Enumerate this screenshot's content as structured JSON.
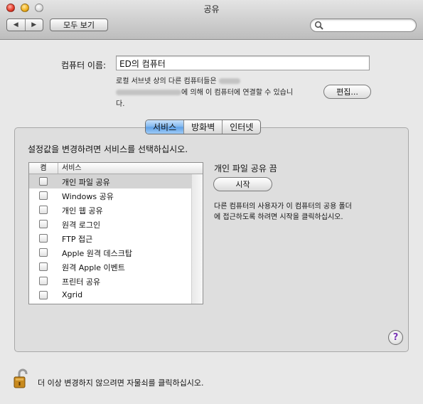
{
  "window": {
    "title": "공유"
  },
  "toolbar": {
    "back_glyph": "◀",
    "forward_glyph": "▶",
    "show_all_label": "모두 보기",
    "search_placeholder": ""
  },
  "computer_name": {
    "label": "컴퓨터 이름:",
    "value": "ED의 컴퓨터",
    "description_line1": "로컬 서브넷 상의 다른 컴퓨터들은",
    "description_line2_suffix": "에 의해 이 컴퓨터에 연결할 수 있습니",
    "description_line3": "다.",
    "edit_button": "편집..."
  },
  "tabs": [
    {
      "label": "서비스",
      "active": true
    },
    {
      "label": "방화벽",
      "active": false
    },
    {
      "label": "인터넷",
      "active": false
    }
  ],
  "services_panel": {
    "instruction": "설정값을 변경하려면 서비스를 선택하십시오.",
    "table": {
      "col_on": "켬",
      "col_service": "서비스",
      "rows": [
        {
          "label": "개인 파일 공유",
          "checked": false,
          "selected": true
        },
        {
          "label": "Windows 공유",
          "checked": false,
          "selected": false
        },
        {
          "label": "개인 웹 공유",
          "checked": false,
          "selected": false
        },
        {
          "label": "원격 로그인",
          "checked": false,
          "selected": false
        },
        {
          "label": "FTP 접근",
          "checked": false,
          "selected": false
        },
        {
          "label": "Apple 원격 데스크탑",
          "checked": false,
          "selected": false
        },
        {
          "label": "원격 Apple 이벤트",
          "checked": false,
          "selected": false
        },
        {
          "label": "프린터 공유",
          "checked": false,
          "selected": false
        },
        {
          "label": "Xgrid",
          "checked": false,
          "selected": false
        }
      ]
    },
    "status_title": "개인 파일 공유 끔",
    "start_button": "시작",
    "status_desc_line1": "다른 컴퓨터의 사용자가 이 컴퓨터의 공용 폴더",
    "status_desc_line2": "에 접근하도록 하려면 시작을 클릭하십시오.",
    "help_glyph": "?"
  },
  "lock": {
    "text": "더 이상 변경하지 않으려면 자물쇠를 클릭하십시오.",
    "icon": "lock-icon"
  },
  "colors": {
    "tab_active": "#7fb6ee",
    "row_selected": "#d4d4d4",
    "lock_gold": "#c88a1e"
  }
}
